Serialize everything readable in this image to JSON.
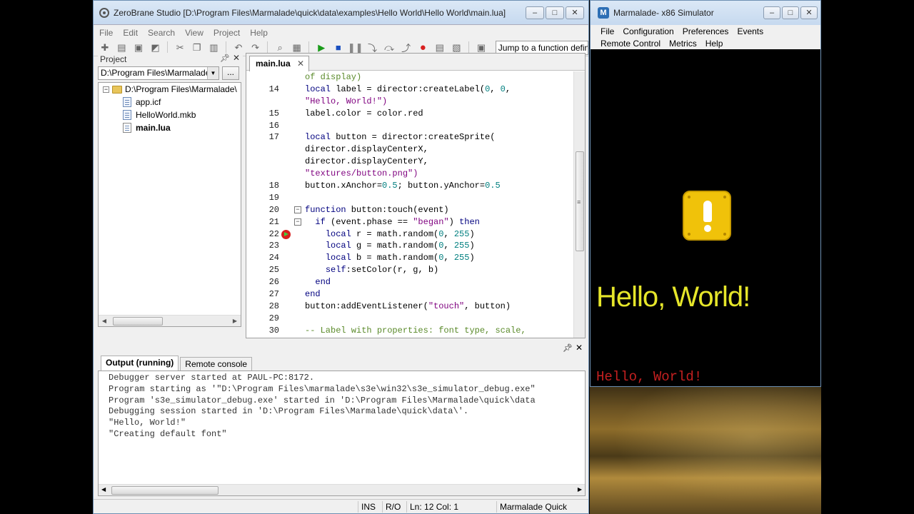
{
  "ide": {
    "title": "ZeroBrane Studio [D:\\Program Files\\Marmalade\\quick\\data\\examples\\Hello World\\Hello World\\main.lua]",
    "window_buttons": [
      "–",
      "□",
      "✕"
    ],
    "menu": [
      "File",
      "Edit",
      "Search",
      "View",
      "Project",
      "Help"
    ],
    "jump_placeholder": "Jump to a function definition"
  },
  "project": {
    "header": "Project",
    "path": "D:\\Program Files\\Marmalade",
    "browse_label": "...",
    "root": "D:\\Program Files\\Marmalade\\",
    "files": [
      "app.icf",
      "HelloWorld.mkb",
      "main.lua"
    ]
  },
  "editor": {
    "tab": "main.lua",
    "tab_close": "✕",
    "lines": [
      {
        "n": "",
        "t": "of display)",
        "c": "cmt"
      },
      {
        "n": "14",
        "t": "local label = director:createLabel(0, 0,"
      },
      {
        "n": "",
        "t": "\"Hello, World!\")",
        "c": "str"
      },
      {
        "n": "15",
        "t": "label.color = color.red"
      },
      {
        "n": "16",
        "t": ""
      },
      {
        "n": "17",
        "t": "local button = director:createSprite("
      },
      {
        "n": "",
        "t": "director.displayCenterX,"
      },
      {
        "n": "",
        "t": "director.displayCenterY,"
      },
      {
        "n": "",
        "t": "\"textures/button.png\")",
        "c": "str"
      },
      {
        "n": "18",
        "t": "button.xAnchor=0.5; button.yAnchor=0.5"
      },
      {
        "n": "19",
        "t": ""
      },
      {
        "n": "20",
        "t": "function button:touch(event)",
        "fold": "−"
      },
      {
        "n": "21",
        "t": "  if (event.phase == \"began\") then",
        "fold": "−"
      },
      {
        "n": "22",
        "t": "    local r = math.random(0, 255)",
        "bp": true
      },
      {
        "n": "23",
        "t": "    local g = math.random(0, 255)"
      },
      {
        "n": "24",
        "t": "    local b = math.random(0, 255)"
      },
      {
        "n": "25",
        "t": "    self:setColor(r, g, b)"
      },
      {
        "n": "26",
        "t": "  end"
      },
      {
        "n": "27",
        "t": "end"
      },
      {
        "n": "28",
        "t": "button:addEventListener(\"touch\", button)"
      },
      {
        "n": "29",
        "t": ""
      },
      {
        "n": "30",
        "t": "-- Label with properties: font type, scale,",
        "c": "cmt"
      }
    ]
  },
  "output": {
    "tabs": [
      "Output (running)",
      "Remote console"
    ],
    "lines": [
      "Debugger server started at PAUL-PC:8172.",
      "Program starting as '\"D:\\Program Files\\marmalade\\s3e\\win32\\s3e_simulator_debug.exe\"",
      "Program 's3e_simulator_debug.exe' started in 'D:\\Program Files\\Marmalade\\quick\\data",
      "Debugging session started in 'D:\\Program Files\\Marmalade\\quick\\data\\'.",
      "\"Hello, World!\"",
      "\"Creating default font\""
    ]
  },
  "status": {
    "ins": "INS",
    "ro": "R/O",
    "pos": "Ln: 12 Col: 1",
    "interp": "Marmalade Quick"
  },
  "simulator": {
    "title": "Marmalade- x86 Simulator",
    "menu_row1": [
      "File",
      "Configuration",
      "Preferences",
      "Events"
    ],
    "menu_row2": [
      "Remote Control",
      "Metrics",
      "Help"
    ],
    "hello_big": "Hello, World!",
    "hello_small": "Hello, World!",
    "colors": {
      "big_text": "#e6e62a",
      "small_text": "#c42020",
      "button": "#f0c20a"
    }
  }
}
